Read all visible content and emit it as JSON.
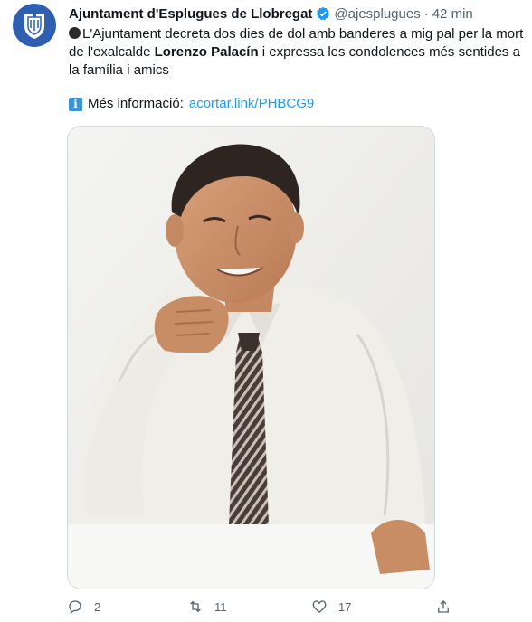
{
  "tweet": {
    "display_name": "Ajuntament d'Esplugues de Llobregat",
    "handle": "@ajesplugues",
    "separator": "·",
    "time": "42 min",
    "text_part1": "L'Ajuntament decreta dos dies de dol amb banderes a mig pal per la mort de l'exalcalde ",
    "text_bold": "Lorenzo Palacín",
    "text_part2": " i expressa les condolences més sentides a la família i amics",
    "info_icon": "i",
    "info_label": "Més informació:",
    "link_text": "acortar.link/PHBCG9",
    "image_alt": "Lorenzo Palacín"
  },
  "actions": {
    "reply_count": "2",
    "retweet_count": "11",
    "like_count": "17"
  },
  "colors": {
    "accent": "#1d9bf0",
    "avatar_bg": "#2f5fb0",
    "muted": "#536471"
  },
  "icons": [
    "seal-icon",
    "verified-badge-icon",
    "black-circle-icon",
    "info-icon",
    "reply-icon",
    "retweet-icon",
    "like-icon",
    "share-icon"
  ]
}
